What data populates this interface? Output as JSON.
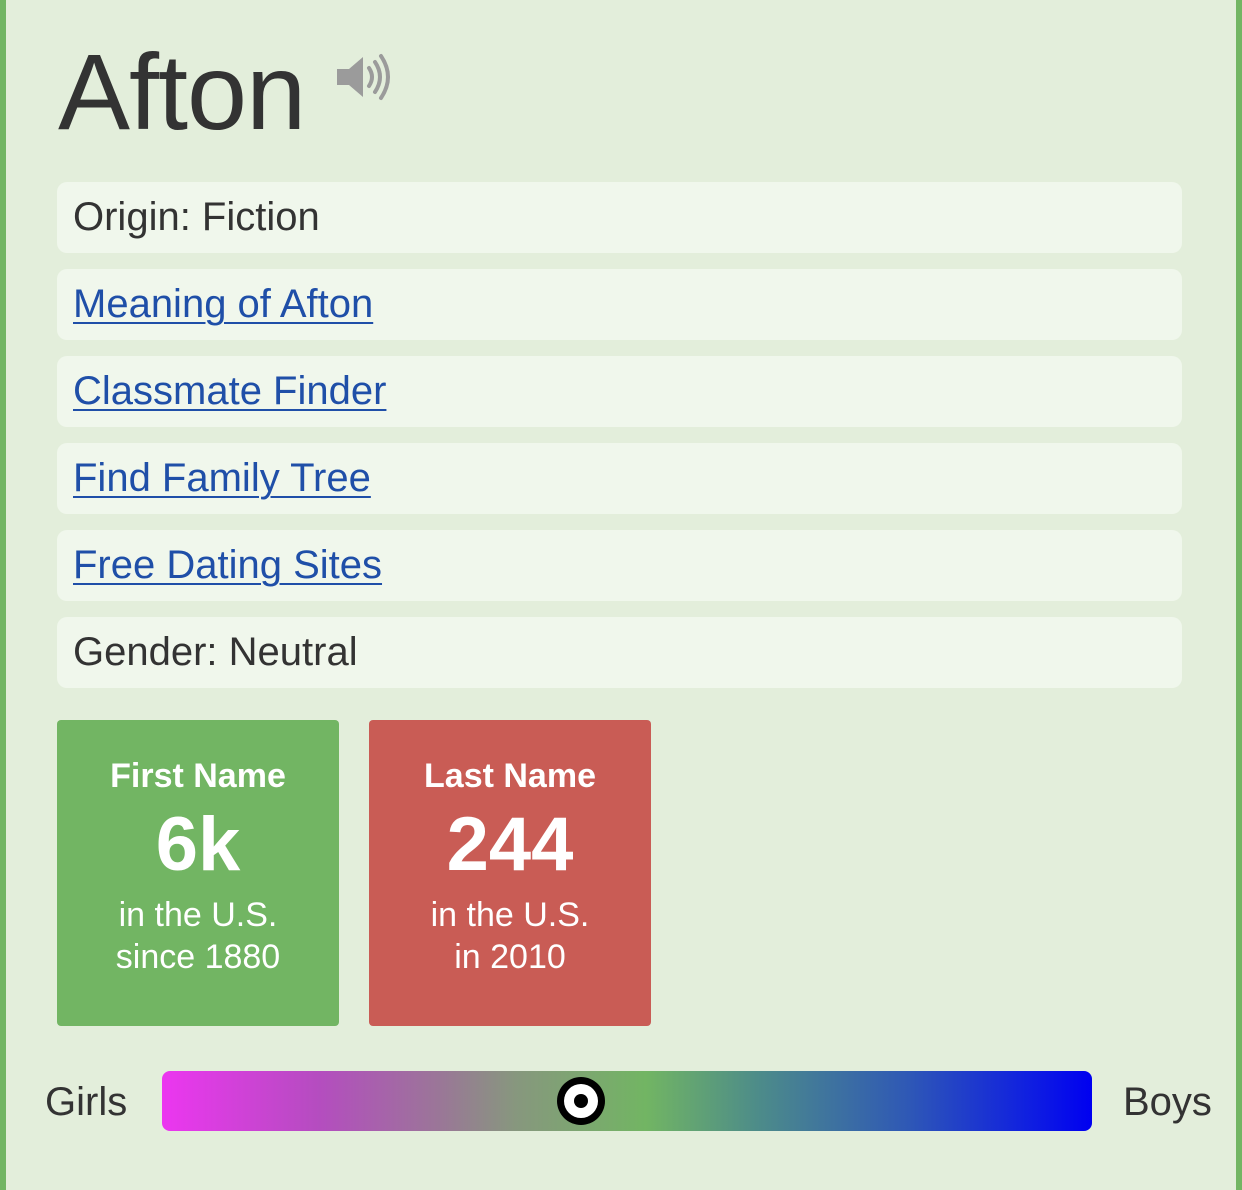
{
  "name": {
    "title": "Afton",
    "pronounce_icon": "speaker-icon"
  },
  "info_rows": [
    {
      "kind": "text",
      "text": "Origin: Fiction"
    },
    {
      "kind": "link",
      "text": "Meaning of Afton"
    },
    {
      "kind": "link",
      "text": "Classmate Finder"
    },
    {
      "kind": "link",
      "text": "Find Family Tree"
    },
    {
      "kind": "link",
      "text": "Free Dating Sites"
    },
    {
      "kind": "text",
      "text": "Gender: Neutral"
    }
  ],
  "stats": {
    "first_name": {
      "label": "First Name",
      "value": "6k",
      "line1": "in the U.S.",
      "line2": "since 1880",
      "color": "#72b563"
    },
    "last_name": {
      "label": "Last Name",
      "value": "244",
      "line1": "in the U.S.",
      "line2": "in 2010",
      "color": "#c95c55"
    }
  },
  "gender_scale": {
    "left_label": "Girls",
    "right_label": "Boys",
    "marker_fraction": 0.45,
    "marker_icon": "target-icon",
    "colors": {
      "girls": "#ec36f0",
      "neutral": "#72b563",
      "boys": "#0000f0"
    }
  },
  "theme": {
    "background": "#e3eedb",
    "border": "#72b563",
    "link": "#1f4fa8",
    "text": "#333333"
  }
}
